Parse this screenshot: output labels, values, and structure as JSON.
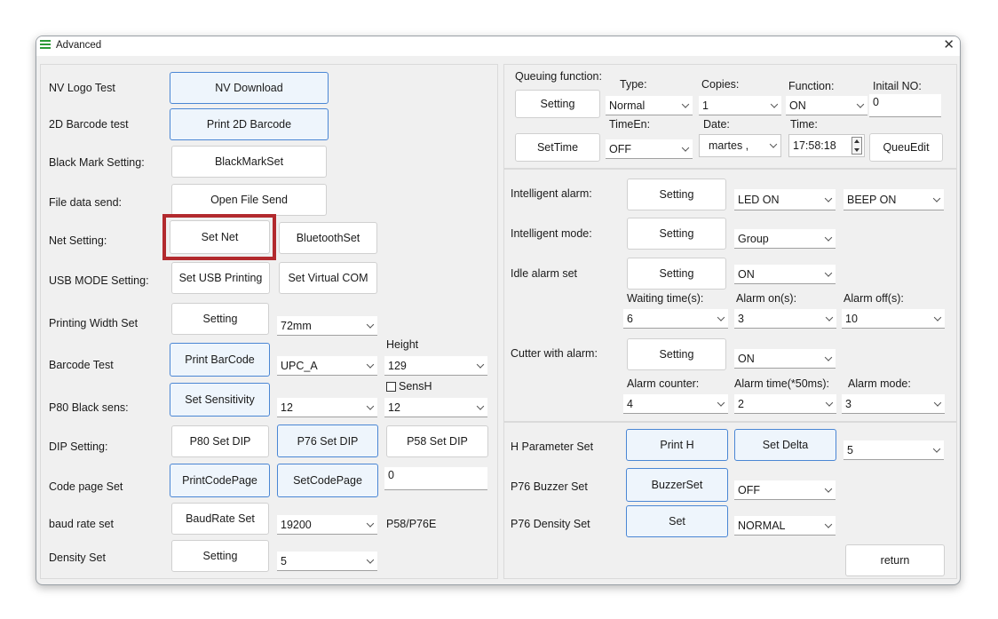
{
  "window": {
    "title": "Advanced"
  },
  "left": {
    "nv_logo": {
      "label": "NV Logo Test",
      "button": "NV Download"
    },
    "barcode2d": {
      "label": "2D Barcode test",
      "button": "Print 2D Barcode"
    },
    "black_mark": {
      "label": "Black Mark Setting:",
      "button": "BlackMarkSet"
    },
    "file_send": {
      "label": "File data send:",
      "button": "Open File Send"
    },
    "net": {
      "label": "Net Setting:",
      "button": "Set Net",
      "button2": "BluetoothSet"
    },
    "usb": {
      "label": "USB MODE Setting:",
      "button": "Set USB Printing",
      "button2": "Set Virtual COM"
    },
    "width": {
      "label": "Printing Width Set",
      "button": "Setting",
      "select": "72mm"
    },
    "barcode": {
      "label": "Barcode Test",
      "button": "Print BarCode",
      "select": "UPC_A",
      "height_label": "Height",
      "height": "129"
    },
    "p80": {
      "label": "P80 Black sens:",
      "button": "Set Sensitivity",
      "select": "12",
      "sensh_label": "SensH",
      "sensh": "12"
    },
    "dip": {
      "label": "DIP Setting:",
      "button": "P80 Set DIP",
      "button2": "P76 Set DIP",
      "button3": "P58 Set DIP"
    },
    "codepage": {
      "label": "Code page Set",
      "button": "PrintCodePage",
      "button2": "SetCodePage",
      "input": "0"
    },
    "baud": {
      "label": "baud rate set",
      "button": "BaudRate Set",
      "select": "19200",
      "note": "P58/P76E"
    },
    "density": {
      "label": "Density Set",
      "button": "Setting",
      "select": "5"
    }
  },
  "queue": {
    "label": "Queuing function:",
    "setting": "Setting",
    "type_label": "Type:",
    "type": "Normal",
    "copies_label": "Copies:",
    "copies": "1",
    "function_label": "Function:",
    "function": "ON",
    "initial_label": "Initail NO:",
    "initial": "0",
    "settime": "SetTime",
    "timeen_label": "TimeEn:",
    "timeen": "OFF",
    "date_label": "Date:",
    "date": "martes  ,",
    "time_label": "Time:",
    "time": "17:58:18",
    "queuedit": "QueuEdit"
  },
  "alarm": {
    "intelligent": {
      "label": "Intelligent alarm:",
      "button": "Setting",
      "led": "LED ON",
      "beep": "BEEP ON"
    },
    "mode": {
      "label": "Intelligent mode:",
      "button": "Setting",
      "select": "Group"
    },
    "idle": {
      "label": "Idle alarm set",
      "button": "Setting",
      "select": "ON",
      "waiting_label": "Waiting time(s):",
      "waiting": "6",
      "on_label": "Alarm on(s):",
      "on": "3",
      "off_label": "Alarm off(s):",
      "off": "10"
    },
    "cutter": {
      "label": "Cutter with alarm:",
      "button": "Setting",
      "select": "ON",
      "counter_label": "Alarm counter:",
      "counter": "4",
      "time_label": "Alarm time(*50ms):",
      "time": "2",
      "mode_label": "Alarm mode:",
      "mode": "3"
    }
  },
  "params": {
    "h": {
      "label": "H Parameter Set",
      "button": "Print H",
      "button2": "Set Delta",
      "select": "5"
    },
    "buzzer": {
      "label": "P76 Buzzer Set",
      "button": "BuzzerSet",
      "select": "OFF"
    },
    "density": {
      "label": "P76 Density Set",
      "button": "Set",
      "select": "NORMAL"
    },
    "return": "return"
  },
  "colors": {
    "highlight": "#b22a2e",
    "accent_border": "#4a86d4"
  }
}
